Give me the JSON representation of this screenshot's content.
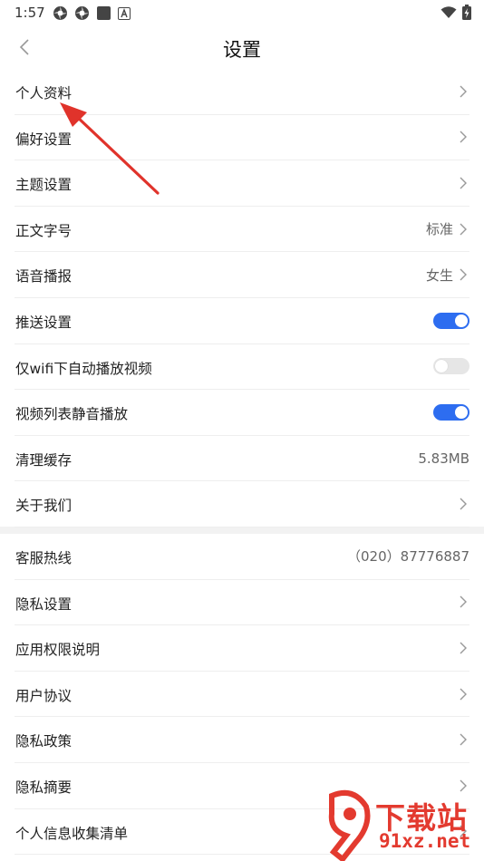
{
  "status_bar": {
    "time": "1:57"
  },
  "nav": {
    "title": "设置"
  },
  "settings_group_1": [
    {
      "label": "个人资料",
      "type": "chevron"
    },
    {
      "label": "偏好设置",
      "type": "chevron"
    },
    {
      "label": "主题设置",
      "type": "chevron"
    },
    {
      "label": "正文字号",
      "type": "value",
      "value": "标准"
    },
    {
      "label": "语音播报",
      "type": "value",
      "value": "女生"
    },
    {
      "label": "推送设置",
      "type": "toggle",
      "on": true
    },
    {
      "label": "仅wifi下自动播放视频",
      "type": "toggle",
      "on": false
    },
    {
      "label": "视频列表静音播放",
      "type": "toggle",
      "on": true
    },
    {
      "label": "清理缓存",
      "type": "text",
      "value": "5.83MB"
    },
    {
      "label": "关于我们",
      "type": "chevron"
    }
  ],
  "settings_group_2": [
    {
      "label": "客服热线",
      "type": "text",
      "value": "（020）87776887"
    },
    {
      "label": "隐私设置",
      "type": "chevron"
    },
    {
      "label": "应用权限说明",
      "type": "chevron"
    },
    {
      "label": "用户协议",
      "type": "chevron"
    },
    {
      "label": "隐私政策",
      "type": "chevron"
    },
    {
      "label": "隐私摘要",
      "type": "chevron"
    },
    {
      "label": "个人信息收集清单",
      "type": "chevron"
    }
  ],
  "watermark": {
    "title": "下载站",
    "domain": "91xz.net"
  },
  "colors": {
    "toggle_on": "#2d6df0",
    "toggle_off": "#e6e6e6",
    "annotation_arrow": "#e0332b",
    "watermark": "#e33a2f"
  }
}
